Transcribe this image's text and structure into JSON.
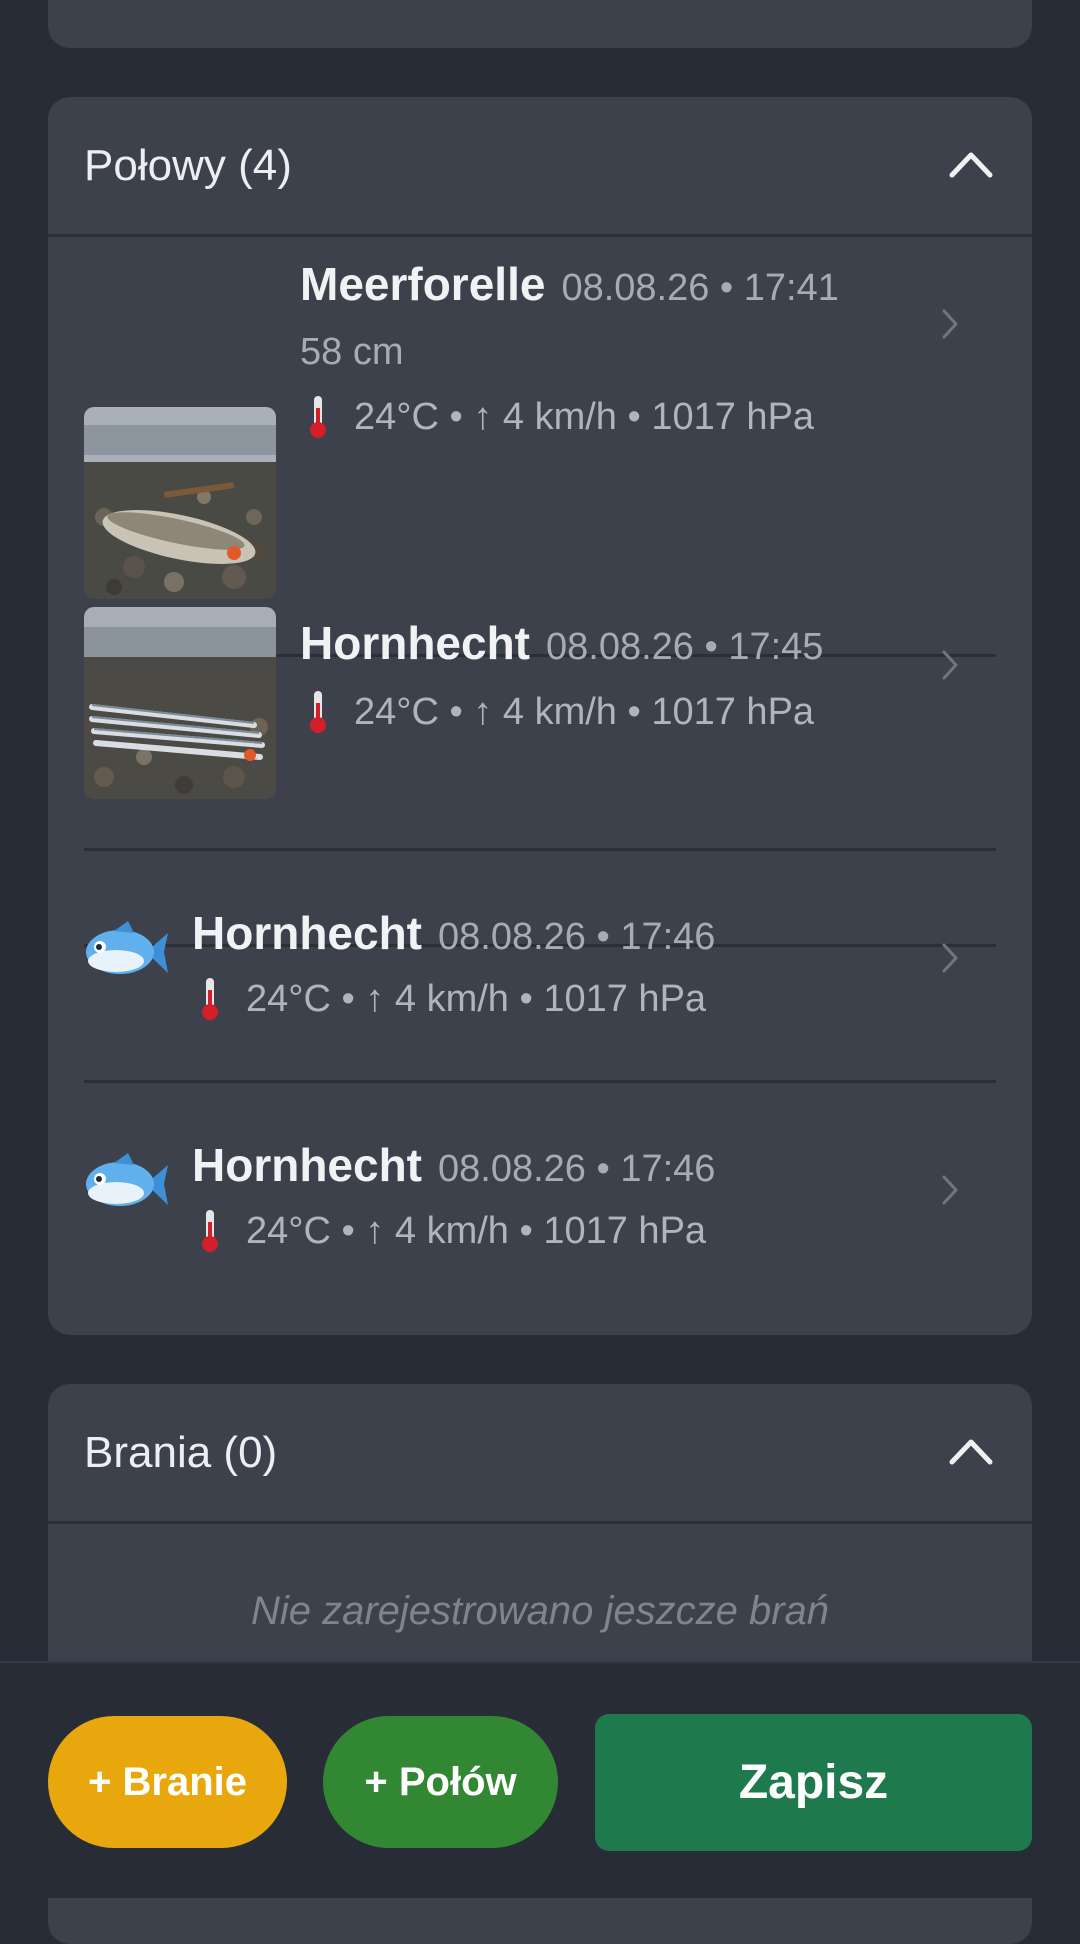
{
  "catches_section": {
    "title": "Połowy (4)",
    "items": [
      {
        "species": "Meerforelle",
        "datetime": "08.08.26 • 17:41",
        "size": "58 cm",
        "weather": "24°C • ↑ 4 km/h • 1017 hPa",
        "thumbnail": "photo-sea-trout"
      },
      {
        "species": "Hornhecht",
        "datetime": "08.08.26 • 17:45",
        "weather": "24°C • ↑ 4 km/h • 1017 hPa",
        "thumbnail": "photo-garfish"
      },
      {
        "species": "Hornhecht",
        "datetime": "08.08.26 • 17:46",
        "weather": "24°C • ↑ 4 km/h • 1017 hPa",
        "thumbnail": "fish-emoji-icon"
      },
      {
        "species": "Hornhecht",
        "datetime": "08.08.26 • 17:46",
        "weather": "24°C • ↑ 4 km/h • 1017 hPa",
        "thumbnail": "fish-emoji-icon"
      }
    ]
  },
  "bites_section": {
    "title": "Brania (0)",
    "empty_text": "Nie zarejestrowano jeszcze brań"
  },
  "actions": {
    "add_bite": "+ Branie",
    "add_catch": "+ Połów",
    "save": "Zapisz"
  },
  "colors": {
    "background": "#282c37",
    "card": "#3c414c",
    "bite_button": "#e8a70c",
    "catch_button": "#318732",
    "save_button": "#1e7a4d"
  }
}
